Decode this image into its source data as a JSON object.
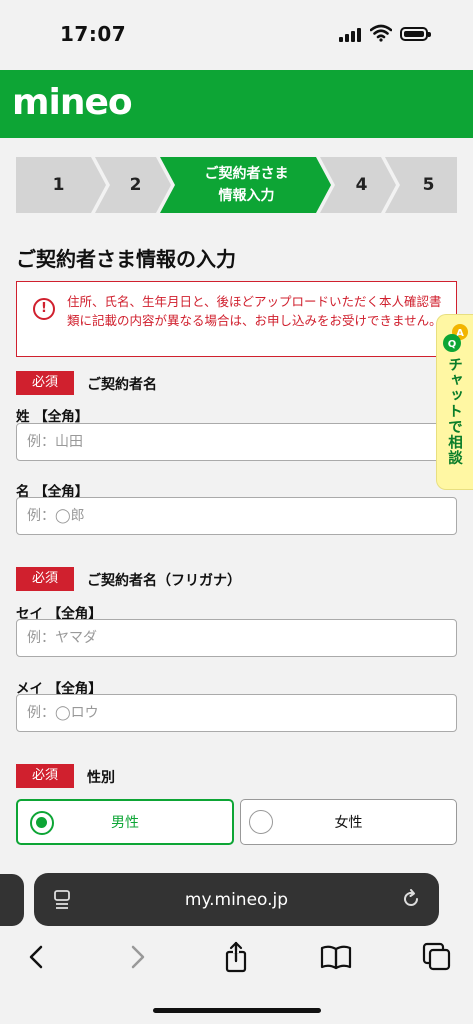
{
  "status_bar": {
    "time": "17:07"
  },
  "header": {
    "logo": "mineo",
    "brand_color": "#0da535"
  },
  "steps": [
    {
      "label": "1",
      "active": false
    },
    {
      "label": "2",
      "active": false
    },
    {
      "label_line1": "ご契約者さま",
      "label_line2": "情報入力",
      "active": true
    },
    {
      "label": "4",
      "active": false
    },
    {
      "label": "5",
      "active": false
    }
  ],
  "page_title": "ご契約者さま情報の入力",
  "alert": {
    "icon": "exclamation-circle-icon",
    "text": "住所、氏名、生年月日と、後ほどアップロードいただく本人確認書類に記載の内容が異なる場合は、お申し込みをお受けできません。",
    "color": "#d0202e"
  },
  "sections": {
    "name": {
      "badge": "必須",
      "label": "ご契約者名",
      "last_label": "姓 【全角】",
      "last_placeholder": "例：山田",
      "first_label": "名 【全角】",
      "first_placeholder": "例：◯郎"
    },
    "kana": {
      "badge": "必須",
      "label": "ご契約者名（フリガナ）",
      "last_label": "セイ 【全角】",
      "last_placeholder": "例：ヤマダ",
      "first_label": "メイ 【全角】",
      "first_placeholder": "例：◯ロウ"
    },
    "gender": {
      "badge": "必須",
      "label": "性別",
      "options": [
        "男性",
        "女性"
      ],
      "selected": "男性"
    }
  },
  "chat_tab": {
    "label": "チャットで相談",
    "icon": "qa-chat-icon"
  },
  "browser": {
    "url": "my.mineo.jp",
    "icons": [
      "page-icon",
      "reload-icon",
      "back-icon",
      "forward-icon",
      "share-icon",
      "bookmarks-icon",
      "tabs-icon"
    ]
  }
}
